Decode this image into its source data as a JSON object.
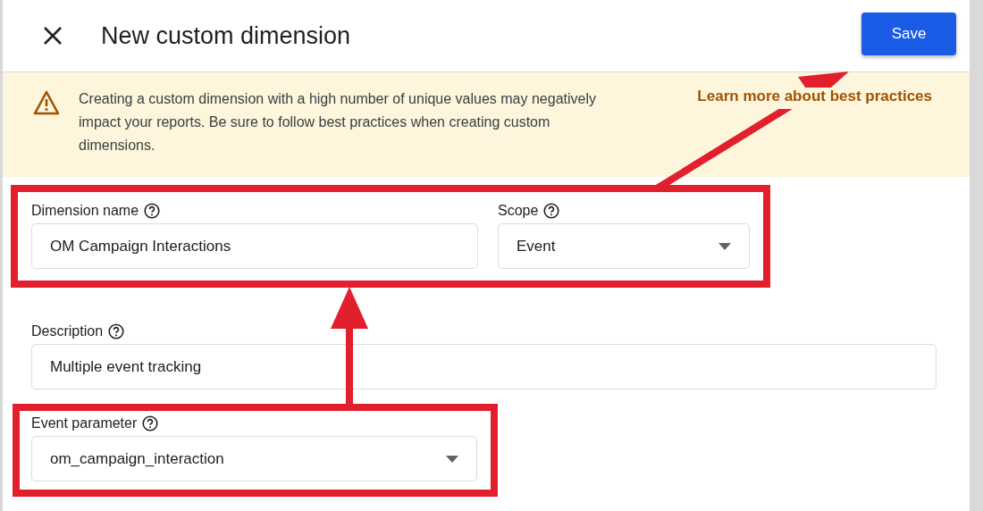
{
  "header": {
    "title": "New custom dimension",
    "save_button": "Save"
  },
  "notice": {
    "message": "Creating a custom dimension with a high number of unique values may negatively impact your reports. Be sure to follow best practices when creating custom dimensions.",
    "link": "Learn more about best practices"
  },
  "fields": [
    {
      "kind": "text",
      "label": "Dimension name",
      "value": "OM Campaign Interactions"
    },
    {
      "kind": "select",
      "label": "Scope",
      "value": "Event"
    },
    {
      "kind": "text",
      "label": "Description",
      "value": "Multiple event tracking"
    },
    {
      "kind": "select",
      "label": "Event parameter",
      "value": "om_campaign_interaction"
    }
  ]
}
